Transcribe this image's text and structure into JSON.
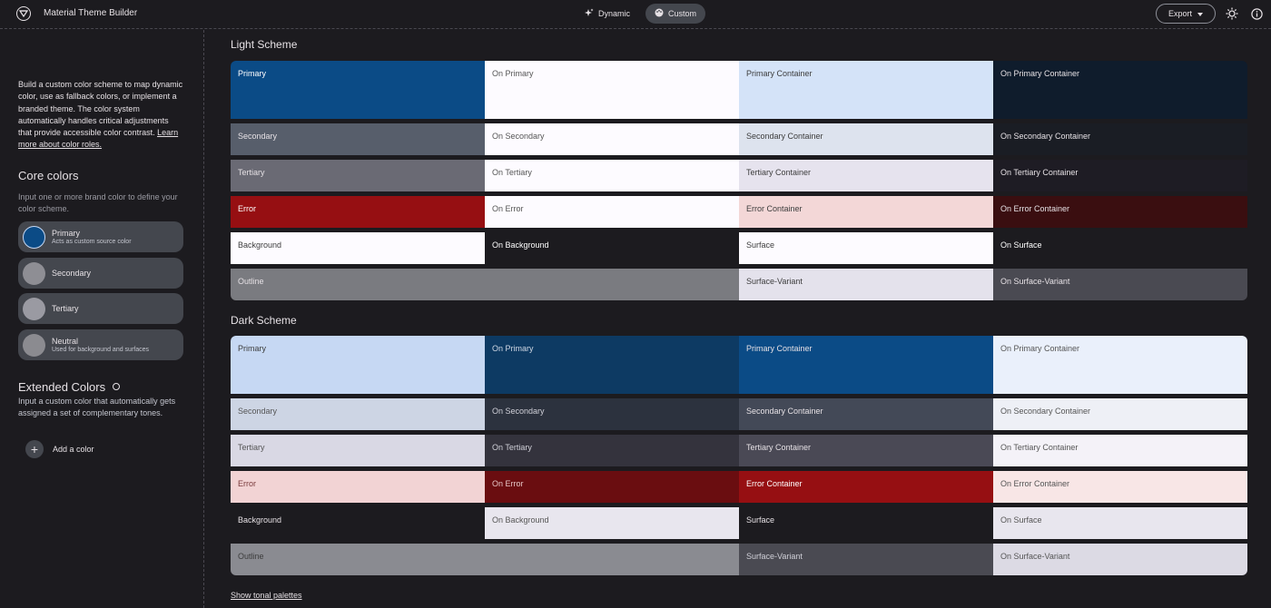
{
  "header": {
    "title": "Material Theme Builder",
    "mode_dynamic": "Dynamic",
    "mode_custom": "Custom",
    "export_label": "Export"
  },
  "sidebar": {
    "intro": "Build a custom color scheme to map dynamic color, use as fallback colors, or implement a branded theme. The color system automatically handles critical adjustments that provide accessible color contrast.",
    "intro_link": "Learn more about color roles.",
    "core_title": "Core colors",
    "core_desc": "Input one or more brand color to define your color scheme.",
    "core_colors": [
      {
        "label": "Primary",
        "sub": "Acts as custom source color",
        "color": "#0b4b86"
      },
      {
        "label": "Secondary",
        "sub": "",
        "color": "#8e8e94"
      },
      {
        "label": "Tertiary",
        "sub": "",
        "color": "#9a9aa2"
      },
      {
        "label": "Neutral",
        "sub": "Used for background and surfaces",
        "color": "#8b8b90"
      }
    ],
    "extended_title": "Extended Colors",
    "extended_desc": "Input a custom color that automatically gets assigned a set of complementary tones.",
    "add_color": "Add a color"
  },
  "light_scheme": {
    "title": "Light Scheme",
    "rows": [
      [
        {
          "label": "Primary",
          "bg": "#0b4b86",
          "fg": "#ffffff"
        },
        {
          "label": "On Primary",
          "bg": "#fdfbff",
          "fg": "#555555"
        },
        {
          "label": "Primary Container",
          "bg": "#d4e3f8",
          "fg": "#3c3c3c"
        },
        {
          "label": "On Primary Container",
          "bg": "#0f1c2c",
          "fg": "#e6e1e5"
        }
      ],
      [
        {
          "label": "Secondary",
          "bg": "#575e6b",
          "fg": "#e6e1e5"
        },
        {
          "label": "On Secondary",
          "bg": "#fdfbff",
          "fg": "#555555"
        },
        {
          "label": "Secondary Container",
          "bg": "#dde3ee",
          "fg": "#3c3c3c"
        },
        {
          "label": "On Secondary Container",
          "bg": "#1a1d24",
          "fg": "#e6e1e5"
        }
      ],
      [
        {
          "label": "Tertiary",
          "bg": "#6a6a74",
          "fg": "#e6e1e5"
        },
        {
          "label": "On Tertiary",
          "bg": "#fdfbff",
          "fg": "#555555"
        },
        {
          "label": "Tertiary Container",
          "bg": "#e6e3ee",
          "fg": "#3c3c3c"
        },
        {
          "label": "On Tertiary Container",
          "bg": "#1e1c24",
          "fg": "#e6e1e5"
        }
      ],
      [
        {
          "label": "Error",
          "bg": "#960f12",
          "fg": "#ffffff"
        },
        {
          "label": "On Error",
          "bg": "#fdfbff",
          "fg": "#555555"
        },
        {
          "label": "Error Container",
          "bg": "#f3d7d7",
          "fg": "#3c3c3c"
        },
        {
          "label": "On Error Container",
          "bg": "#3a0e10",
          "fg": "#e6e1e5"
        }
      ],
      [
        {
          "label": "Background",
          "bg": "#fdfbff",
          "fg": "#3c3c3c"
        },
        {
          "label": "On Background",
          "bg": "#1c1b1f",
          "fg": "#ffffff"
        },
        {
          "label": "Surface",
          "bg": "#fdfbff",
          "fg": "#3c3c3c"
        },
        {
          "label": "On Surface",
          "bg": "#1c1b1f",
          "fg": "#ffffff"
        }
      ],
      [
        {
          "label": "Outline",
          "bg": "#7a7b80",
          "fg": "#e6e1e5",
          "span": 2
        },
        {
          "label": "Surface-Variant",
          "bg": "#e4e2ec",
          "fg": "#3c3c3c"
        },
        {
          "label": "On Surface-Variant",
          "bg": "#4a4a52",
          "fg": "#e6e1e5"
        }
      ]
    ]
  },
  "dark_scheme": {
    "title": "Dark Scheme",
    "rows": [
      [
        {
          "label": "Primary",
          "bg": "#c6d8f3",
          "fg": "#3c3c3c"
        },
        {
          "label": "On Primary",
          "bg": "#0d3a63",
          "fg": "#d0d8e4"
        },
        {
          "label": "Primary Container",
          "bg": "#0b4b86",
          "fg": "#e6e1e5"
        },
        {
          "label": "On Primary Container",
          "bg": "#eaf0fb",
          "fg": "#555555"
        }
      ],
      [
        {
          "label": "Secondary",
          "bg": "#cdd5e4",
          "fg": "#555555"
        },
        {
          "label": "On Secondary",
          "bg": "#2c323e",
          "fg": "#d0d0d8"
        },
        {
          "label": "Secondary Container",
          "bg": "#434957",
          "fg": "#e6e1e5"
        },
        {
          "label": "On Secondary Container",
          "bg": "#eef0f6",
          "fg": "#555555"
        }
      ],
      [
        {
          "label": "Tertiary",
          "bg": "#d9d8e4",
          "fg": "#555555"
        },
        {
          "label": "On Tertiary",
          "bg": "#34333d",
          "fg": "#d0d0d8"
        },
        {
          "label": "Tertiary Container",
          "bg": "#4a4955",
          "fg": "#e6e1e5"
        },
        {
          "label": "On Tertiary Container",
          "bg": "#f4f2f8",
          "fg": "#555555"
        }
      ],
      [
        {
          "label": "Error",
          "bg": "#f2d3d4",
          "fg": "#7a3a3c"
        },
        {
          "label": "On Error",
          "bg": "#6a0d10",
          "fg": "#e6c6c6"
        },
        {
          "label": "Error Container",
          "bg": "#960f12",
          "fg": "#ffffff"
        },
        {
          "label": "On Error Container",
          "bg": "#f8e6e6",
          "fg": "#555555"
        }
      ],
      [
        {
          "label": "Background",
          "bg": "#1c1b1f",
          "fg": "#e6e1e5"
        },
        {
          "label": "On Background",
          "bg": "#e8e6ee",
          "fg": "#555555"
        },
        {
          "label": "Surface",
          "bg": "#1c1b1f",
          "fg": "#e6e1e5"
        },
        {
          "label": "On Surface",
          "bg": "#e8e6ee",
          "fg": "#555555"
        }
      ],
      [
        {
          "label": "Outline",
          "bg": "#8a8b91",
          "fg": "#3c3c3c",
          "span": 2
        },
        {
          "label": "Surface-Variant",
          "bg": "#4a4a52",
          "fg": "#d0d0d8"
        },
        {
          "label": "On Surface-Variant",
          "bg": "#dcdae4",
          "fg": "#555555"
        }
      ]
    ]
  },
  "footer": {
    "show_tonal": "Show tonal palettes"
  }
}
